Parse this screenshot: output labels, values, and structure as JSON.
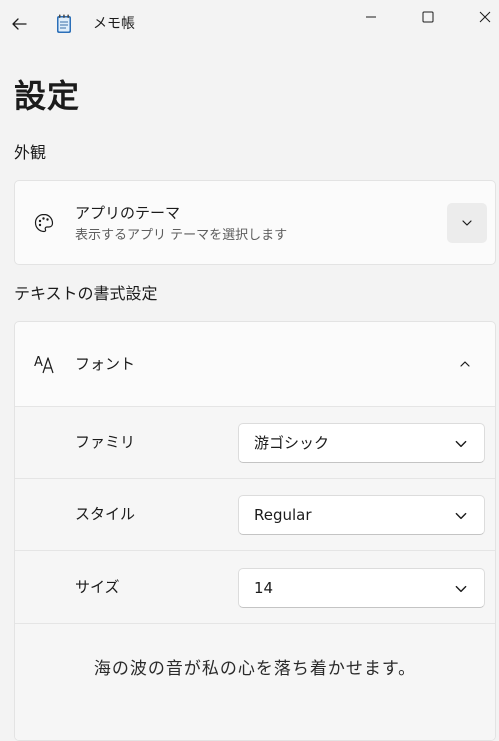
{
  "app": {
    "title": "メモ帳"
  },
  "page": {
    "title": "設定"
  },
  "sections": {
    "appearance": "外観",
    "text_format": "テキストの書式設定"
  },
  "theme": {
    "title": "アプリのテーマ",
    "description": "表示するアプリ テーマを選択します"
  },
  "font": {
    "title": "フォント",
    "family_label": "ファミリ",
    "family_value": "游ゴシック",
    "style_label": "スタイル",
    "style_value": "Regular",
    "size_label": "サイズ",
    "size_value": "14",
    "preview_text": "海の波の音が私の心を落ち着かせます。"
  },
  "icons": {
    "back": "back-arrow-icon",
    "app": "notepad-icon",
    "minimize": "minimize-icon",
    "maximize": "maximize-icon",
    "close": "close-icon",
    "theme": "palette-icon",
    "font": "font-icon",
    "chevron_down": "chevron-down-icon",
    "chevron_up": "chevron-up-icon"
  },
  "colors": {
    "background": "#f3f3f3",
    "card": "#fbfbfb",
    "accent_icon": "#1f7fd4"
  }
}
